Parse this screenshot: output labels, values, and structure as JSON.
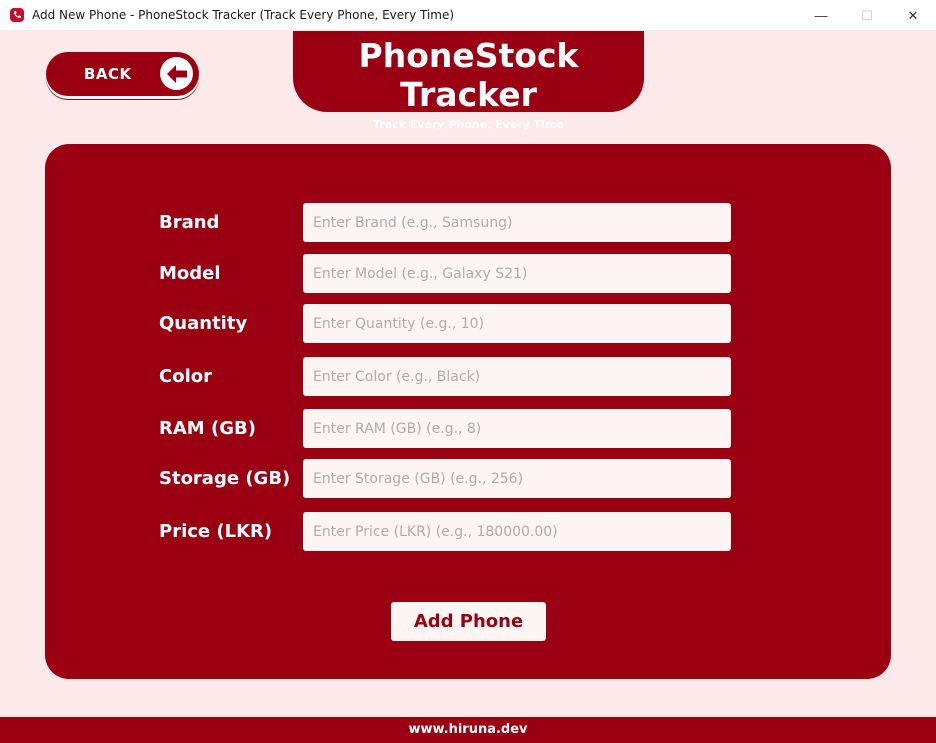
{
  "window": {
    "title": "Add New Phone - PhoneStock Tracker (Track Every Phone, Every Time)",
    "controls": {
      "minimize": "—",
      "maximize": "☐",
      "close": "✕"
    },
    "icon": "phone-app-icon"
  },
  "back_button": {
    "label": "BACK",
    "icon": "arrow-left-icon"
  },
  "banner": {
    "app_name": "PhoneStock Tracker",
    "tagline": "Track Every Phone, Every Time"
  },
  "form": {
    "fields": [
      {
        "label": "Brand",
        "placeholder": "Enter Brand (e.g., Samsung)",
        "value": ""
      },
      {
        "label": "Model",
        "placeholder": "Enter Model (e.g., Galaxy S21)",
        "value": ""
      },
      {
        "label": "Quantity",
        "placeholder": "Enter Quantity (e.g., 10)",
        "value": ""
      },
      {
        "label": "Color",
        "placeholder": "Enter Color (e.g., Black)",
        "value": ""
      },
      {
        "label": "RAM (GB)",
        "placeholder": "Enter RAM (GB) (e.g., 8)",
        "value": ""
      },
      {
        "label": "Storage (GB)",
        "placeholder": "Enter Storage (GB) (e.g., 256)",
        "value": ""
      },
      {
        "label": "Price (LKR)",
        "placeholder": "Enter Price (LKR) (e.g., 180000.00)",
        "value": ""
      }
    ],
    "submit_label": "Add Phone"
  },
  "footer": {
    "site": "www.hiruna.dev"
  },
  "colors": {
    "brand": "#9b0012",
    "background": "#fce9ea",
    "input_bg": "#fdf4f4",
    "placeholder": "#b8a9aa"
  }
}
